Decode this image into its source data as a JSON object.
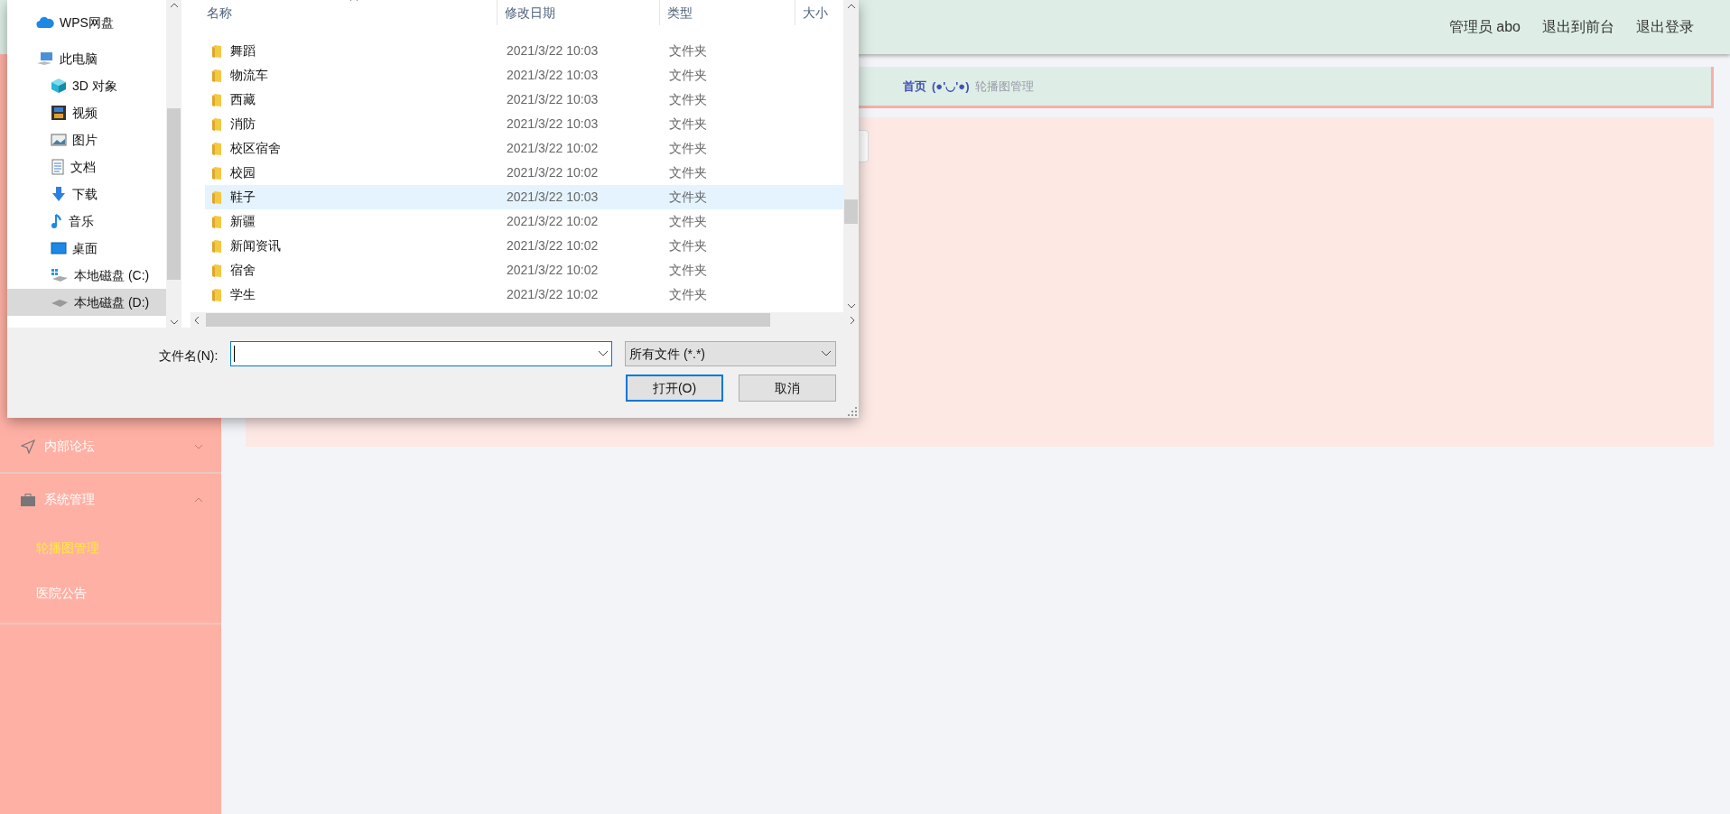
{
  "header": {
    "user": "管理员 abo",
    "links": [
      "退出到前台",
      "退出登录"
    ]
  },
  "breadcrumb": {
    "home": "首页",
    "separator": "(●'◡'●)",
    "current": "轮播图管理"
  },
  "sidebar": {
    "items": [
      {
        "label": "内部论坛",
        "kind": "send",
        "expanded": false
      },
      {
        "label": "系统管理",
        "kind": "briefcase",
        "expanded": true,
        "children": [
          {
            "label": "轮播图管理",
            "selected": true
          },
          {
            "label": "医院公告",
            "selected": false
          }
        ]
      }
    ]
  },
  "dialog": {
    "nav": [
      {
        "label": "WPS网盘",
        "kind": "cloud",
        "selected": false
      },
      {
        "label": "此电脑",
        "kind": "pc",
        "selected": false,
        "children": [
          {
            "label": "3D 对象",
            "kind": "cube",
            "selected": false
          },
          {
            "label": "视频",
            "kind": "film",
            "selected": false
          },
          {
            "label": "图片",
            "kind": "picture",
            "selected": false
          },
          {
            "label": "文档",
            "kind": "document",
            "selected": false
          },
          {
            "label": "下载",
            "kind": "download",
            "selected": false
          },
          {
            "label": "音乐",
            "kind": "music",
            "selected": false
          },
          {
            "label": "桌面",
            "kind": "desktop",
            "selected": false
          },
          {
            "label": "本地磁盘 (C:)",
            "kind": "system-drive",
            "selected": false
          },
          {
            "label": "本地磁盘 (D:)",
            "kind": "drive",
            "selected": true
          }
        ]
      }
    ],
    "columns": [
      "名称",
      "修改日期",
      "类型",
      "大小"
    ],
    "rows": [
      {
        "name": "舞蹈",
        "date": "2021/3/22 10:03",
        "type": "文件夹",
        "selected": false
      },
      {
        "name": "物流车",
        "date": "2021/3/22 10:03",
        "type": "文件夹",
        "selected": false
      },
      {
        "name": "西藏",
        "date": "2021/3/22 10:03",
        "type": "文件夹",
        "selected": false
      },
      {
        "name": "消防",
        "date": "2021/3/22 10:03",
        "type": "文件夹",
        "selected": false
      },
      {
        "name": "校区宿舍",
        "date": "2021/3/22 10:02",
        "type": "文件夹",
        "selected": false
      },
      {
        "name": "校园",
        "date": "2021/3/22 10:02",
        "type": "文件夹",
        "selected": false
      },
      {
        "name": "鞋子",
        "date": "2021/3/22 10:03",
        "type": "文件夹",
        "selected": true
      },
      {
        "name": "新疆",
        "date": "2021/3/22 10:02",
        "type": "文件夹",
        "selected": false
      },
      {
        "name": "新闻资讯",
        "date": "2021/3/22 10:02",
        "type": "文件夹",
        "selected": false
      },
      {
        "name": "宿舍",
        "date": "2021/3/22 10:02",
        "type": "文件夹",
        "selected": false
      },
      {
        "name": "学生",
        "date": "2021/3/22 10:02",
        "type": "文件夹",
        "selected": false
      }
    ],
    "filename_label": "文件名(N):",
    "filter": "所有文件 (*.*)",
    "buttons": [
      "打开(O)",
      "取消"
    ]
  }
}
